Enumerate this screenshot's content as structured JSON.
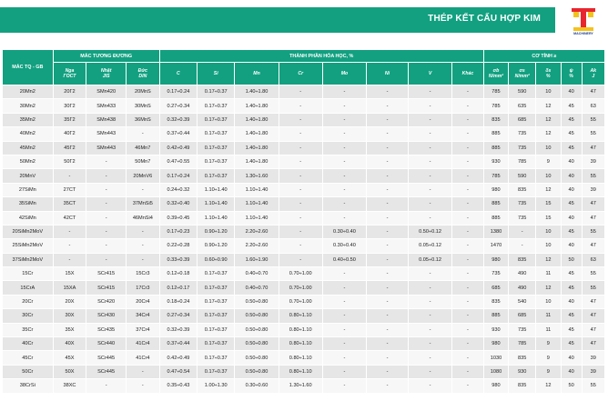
{
  "header": {
    "title": "THÉP KẾT CẤU HỢP KIM",
    "logo_text": "MACHINERY",
    "band_color": "#12a080"
  },
  "table": {
    "group_headers": {
      "grade": "MÁC TQ - GB",
      "equivalents": "MÁC TƯƠNG ĐƯƠNG",
      "composition": "THÀNH PHẦN HÓA HỌC, %",
      "mechanical": "CƠ TÍNH ≥"
    },
    "sub_headers": [
      [
        "Nga",
        "ГОСТ"
      ],
      [
        "Nhật",
        "JIS"
      ],
      [
        "Đức",
        "DIN"
      ],
      [
        "C",
        ""
      ],
      [
        "Si",
        ""
      ],
      [
        "Mn",
        ""
      ],
      [
        "Cr",
        ""
      ],
      [
        "Mo",
        ""
      ],
      [
        "Ni",
        ""
      ],
      [
        "V",
        ""
      ],
      [
        "Khác",
        ""
      ],
      [
        "σb",
        "N/mm²"
      ],
      [
        "σs",
        "N/mm²"
      ],
      [
        "δs",
        "%"
      ],
      [
        "ψ",
        "%"
      ],
      [
        "Ak",
        "J"
      ]
    ],
    "rows": [
      [
        "20Mn2",
        "20Г2",
        "SMn420",
        "20MnS",
        "0.17÷0.24",
        "0.17÷0.37",
        "1.40÷1.80",
        "-",
        "-",
        "-",
        "-",
        "-",
        "785",
        "590",
        "10",
        "40",
        "47"
      ],
      [
        "30Mn2",
        "30Г2",
        "SMn433",
        "30MnS",
        "0.27÷0.34",
        "0.17÷0.37",
        "1.40÷1.80",
        "-",
        "-",
        "-",
        "-",
        "-",
        "785",
        "635",
        "12",
        "45",
        "63"
      ],
      [
        "35Mn2",
        "35Г2",
        "SMn438",
        "36MnS",
        "0.32÷0.39",
        "0.17÷0.37",
        "1.40÷1.80",
        "-",
        "-",
        "-",
        "-",
        "-",
        "835",
        "685",
        "12",
        "45",
        "55"
      ],
      [
        "40Mn2",
        "40Г2",
        "SMn443",
        "-",
        "0.37÷0.44",
        "0.17÷0.37",
        "1.40÷1.80",
        "-",
        "-",
        "-",
        "-",
        "-",
        "885",
        "735",
        "12",
        "45",
        "55"
      ],
      [
        "45Mn2",
        "45Г2",
        "SMn443",
        "46Mn7",
        "0.42÷0.49",
        "0.17÷0.37",
        "1.40÷1.80",
        "-",
        "-",
        "-",
        "-",
        "-",
        "885",
        "735",
        "10",
        "45",
        "47"
      ],
      [
        "50Mn2",
        "50Г2",
        "-",
        "50Mn7",
        "0.47÷0.55",
        "0.17÷0.37",
        "1.40÷1.80",
        "-",
        "-",
        "-",
        "-",
        "-",
        "930",
        "785",
        "9",
        "40",
        "39"
      ],
      [
        "20MnV",
        "-",
        "-",
        "20MnV6",
        "0.17÷0.24",
        "0.17÷0.37",
        "1.30÷1.60",
        "-",
        "-",
        "-",
        "-",
        "-",
        "785",
        "590",
        "10",
        "40",
        "55"
      ],
      [
        "27SiMn",
        "27CT",
        "-",
        "-",
        "0.24÷0.32",
        "1.10÷1.40",
        "1.10÷1.40",
        "-",
        "-",
        "-",
        "-",
        "-",
        "980",
        "835",
        "12",
        "40",
        "39"
      ],
      [
        "35SiMn",
        "35CT",
        "-",
        "37MnSi5",
        "0.32÷0.40",
        "1.10÷1.40",
        "1.10÷1.40",
        "-",
        "-",
        "-",
        "-",
        "-",
        "885",
        "735",
        "15",
        "45",
        "47"
      ],
      [
        "42SiMn",
        "42CT",
        "-",
        "46MnSi4",
        "0.39÷0.45",
        "1.10÷1.40",
        "1.10÷1.40",
        "-",
        "-",
        "-",
        "-",
        "-",
        "885",
        "735",
        "15",
        "40",
        "47"
      ],
      [
        "20SiMn2MoV",
        "-",
        "-",
        "-",
        "0.17÷0.23",
        "0.90÷1.20",
        "2.20÷2.60",
        "-",
        "0.30÷0.40",
        "-",
        "0.50÷0.12",
        "-",
        "1380",
        "-",
        "10",
        "45",
        "55"
      ],
      [
        "25SiMn2MoV",
        "-",
        "-",
        "-",
        "0.22÷0.28",
        "0.90÷1.20",
        "2.20÷2.60",
        "-",
        "0.30÷0.40",
        "-",
        "0.05÷0.12",
        "-",
        "1470",
        "-",
        "10",
        "40",
        "47"
      ],
      [
        "37SiMn2MoV",
        "-",
        "-",
        "-",
        "0.33÷0.39",
        "0.60÷0.90",
        "1.60÷1.90",
        "-",
        "0.40÷0.50",
        "-",
        "0.05÷0.12",
        "-",
        "980",
        "835",
        "12",
        "50",
        "63"
      ],
      [
        "15Cr",
        "15X",
        "SCr415",
        "15Cr3",
        "0.12÷0.18",
        "0.17÷0.37",
        "0.40÷0.70",
        "0.70÷1.00",
        "-",
        "-",
        "-",
        "-",
        "735",
        "490",
        "11",
        "45",
        "55"
      ],
      [
        "15CrA",
        "15XA",
        "SCr415",
        "17Cr3",
        "0.12÷0.17",
        "0.17÷0.37",
        "0.40÷0.70",
        "0.70÷1.00",
        "-",
        "-",
        "-",
        "-",
        "685",
        "490",
        "12",
        "45",
        "55"
      ],
      [
        "20Cr",
        "20X",
        "SCr420",
        "20Cr4",
        "0.18÷0.24",
        "0.17÷0.37",
        "0.50÷0.80",
        "0.70÷1.00",
        "-",
        "-",
        "-",
        "-",
        "835",
        "540",
        "10",
        "40",
        "47"
      ],
      [
        "30Cr",
        "30X",
        "SCr430",
        "34Cr4",
        "0.27÷0.34",
        "0.17÷0.37",
        "0.50÷0.80",
        "0.80÷1.10",
        "-",
        "-",
        "-",
        "-",
        "885",
        "685",
        "11",
        "45",
        "47"
      ],
      [
        "35Cr",
        "35X",
        "SCr435",
        "37Cr4",
        "0.32÷0.39",
        "0.17÷0.37",
        "0.50÷0.80",
        "0.80÷1.10",
        "-",
        "-",
        "-",
        "-",
        "930",
        "735",
        "11",
        "45",
        "47"
      ],
      [
        "40Cr",
        "40X",
        "SCr440",
        "41Cr4",
        "0.37÷0.44",
        "0.17÷0.37",
        "0.50÷0.80",
        "0.80÷1.10",
        "-",
        "-",
        "-",
        "-",
        "980",
        "785",
        "9",
        "45",
        "47"
      ],
      [
        "45Cr",
        "45X",
        "SCr445",
        "41Cr4",
        "0.42÷0.49",
        "0.17÷0.37",
        "0.50÷0.80",
        "0.80÷1.10",
        "-",
        "-",
        "-",
        "-",
        "1030",
        "835",
        "9",
        "40",
        "39"
      ],
      [
        "50Cr",
        "50X",
        "SCr445",
        "-",
        "0.47÷0.54",
        "0.17÷0.37",
        "0.50÷0.80",
        "0.80÷1.10",
        "-",
        "-",
        "-",
        "-",
        "1080",
        "930",
        "9",
        "40",
        "39"
      ],
      [
        "38CrSi",
        "38XC",
        "-",
        "-",
        "0.35÷0.43",
        "1.00÷1.30",
        "0.30÷0.60",
        "1.30÷1.60",
        "-",
        "-",
        "-",
        "-",
        "980",
        "835",
        "12",
        "50",
        "55"
      ]
    ]
  }
}
